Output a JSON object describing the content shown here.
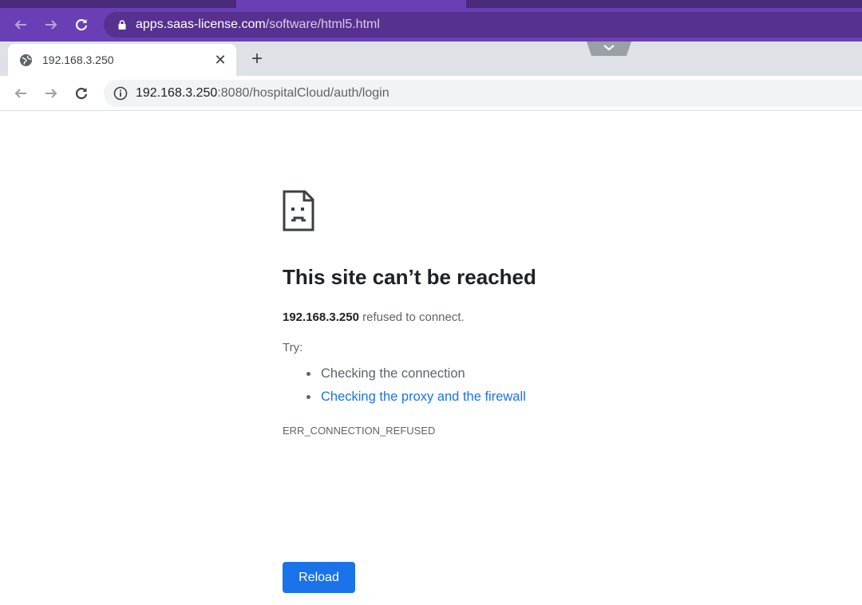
{
  "outer_browser": {
    "url_host": "apps.saas-license.com",
    "url_path": "/software/html5.html",
    "icons": [
      "back-arrow-icon",
      "forward-arrow-icon",
      "reload-icon",
      "lock-icon"
    ],
    "colors": {
      "toolbar": "#6a3fb5",
      "omnibox": "#57318f",
      "tabstrip": "#4a2a7a"
    }
  },
  "tab": {
    "title": "192.168.3.250",
    "close_glyph": "✕",
    "new_tab_glyph": "+"
  },
  "address_bar": {
    "url_host": "192.168.3.250",
    "url_rest": ":8080/hospitalCloud/auth/login",
    "icons": [
      "back-arrow-icon",
      "forward-arrow-icon",
      "reload-icon",
      "info-icon"
    ]
  },
  "error_page": {
    "icon": "sad-page-icon",
    "headline": "This site can’t be reached",
    "host": "192.168.3.250",
    "summary_rest": " refused to connect.",
    "try_label": "Try:",
    "suggestions": [
      {
        "text": "Checking the connection",
        "is_link": false
      },
      {
        "text": "Checking the proxy and the firewall",
        "is_link": true
      }
    ],
    "error_code": "ERR_CONNECTION_REFUSED",
    "reload_label": "Reload",
    "colors": {
      "link": "#1a73e8",
      "button": "#1a73e8"
    }
  }
}
